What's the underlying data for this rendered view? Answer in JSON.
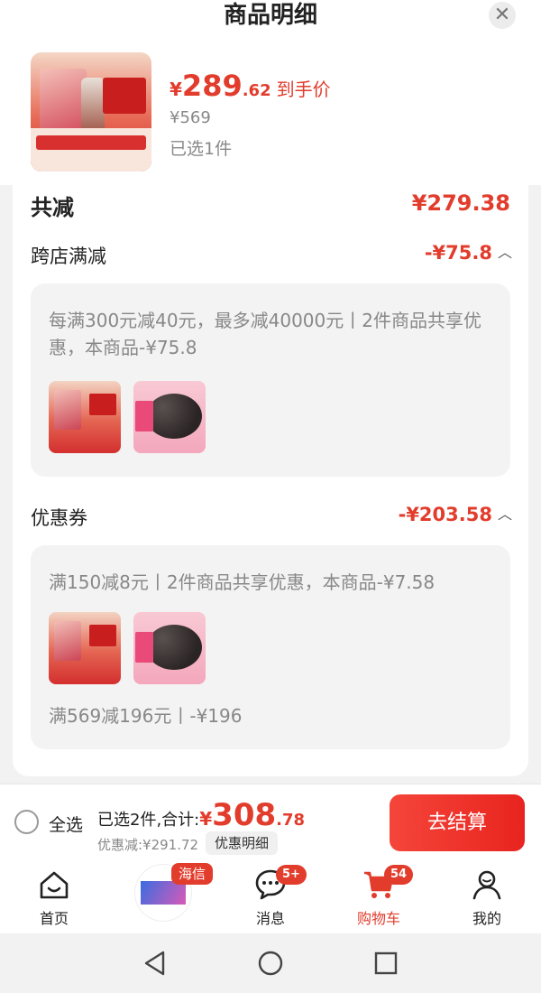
{
  "sheet": {
    "title": "商品明细",
    "close_icon": "close-icon"
  },
  "product": {
    "price_currency": "¥",
    "price_int": "289",
    "price_dec": ".62",
    "price_tag": "到手价",
    "original_price": "¥569",
    "selected_count": "已选1件"
  },
  "summary": {
    "total_label": "共减",
    "total_value": "¥279.38"
  },
  "sections": [
    {
      "label": "跨店满减",
      "value": "-¥75.8",
      "rules": [
        "每满300元减40元，最多减40000元丨2件商品共享优惠，本商品-¥75.8"
      ]
    },
    {
      "label": "优惠券",
      "value": "-¥203.58",
      "rules": [
        "满150减8元丨2件商品共享优惠，本商品-¥7.58",
        "满569减196元丨-¥196"
      ]
    }
  ],
  "checkout_bar": {
    "select_all": "全选",
    "summary_prefix": "已选2件,合计:",
    "total_currency": "¥",
    "total_int": "308",
    "total_dec": ".78",
    "discount": "优惠减:¥291.72",
    "detail_button": "优惠明细",
    "checkout_button": "去结算"
  },
  "tabbar": {
    "items": [
      {
        "label": "首页",
        "icon": "home-icon"
      },
      {
        "label": "",
        "icon": "ad-tv-icon"
      },
      {
        "label": "消息",
        "icon": "chat-icon",
        "badge": "5+"
      },
      {
        "label": "购物车",
        "icon": "cart-icon",
        "badge": "54",
        "active": true
      },
      {
        "label": "我的",
        "icon": "profile-icon"
      }
    ],
    "ad_tag": "海信"
  },
  "colors": {
    "accent": "#e23c2c",
    "muted": "#888888"
  }
}
